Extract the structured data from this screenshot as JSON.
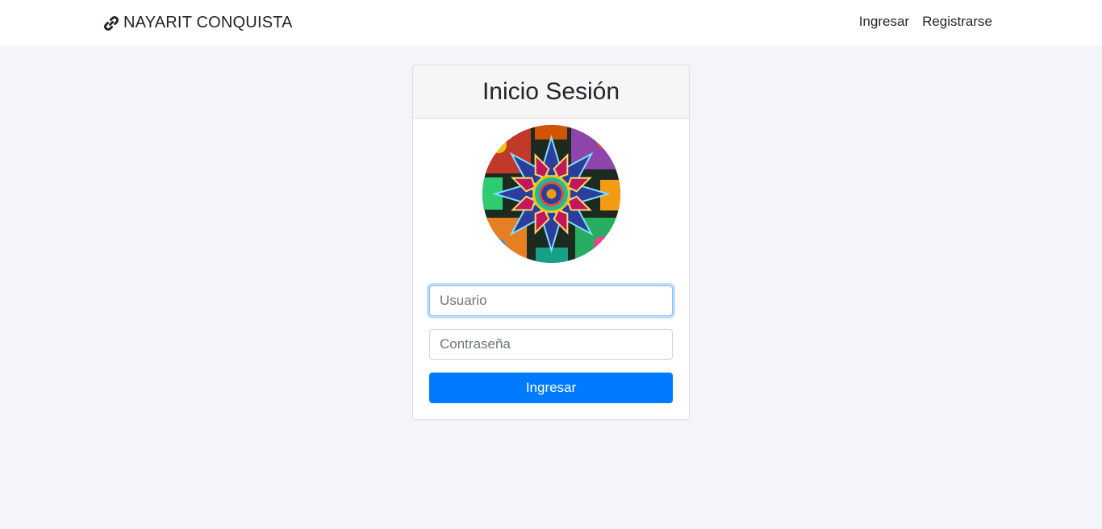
{
  "navbar": {
    "brand_text": "NAYARIT CONQUISTA",
    "brand_icon": "link-icon",
    "links": [
      "Ingresar",
      "Registrarse"
    ]
  },
  "login": {
    "title": "Inicio Sesión",
    "avatar_description": "huichol-beadwork-mandala-image",
    "username_placeholder": "Usuario",
    "password_placeholder": "Contraseña",
    "submit_label": "Ingresar"
  },
  "colors": {
    "page_background": "#f4f5f9",
    "navbar_background": "#ffffff",
    "primary": "#007bff",
    "focus_border": "#80bdff"
  }
}
